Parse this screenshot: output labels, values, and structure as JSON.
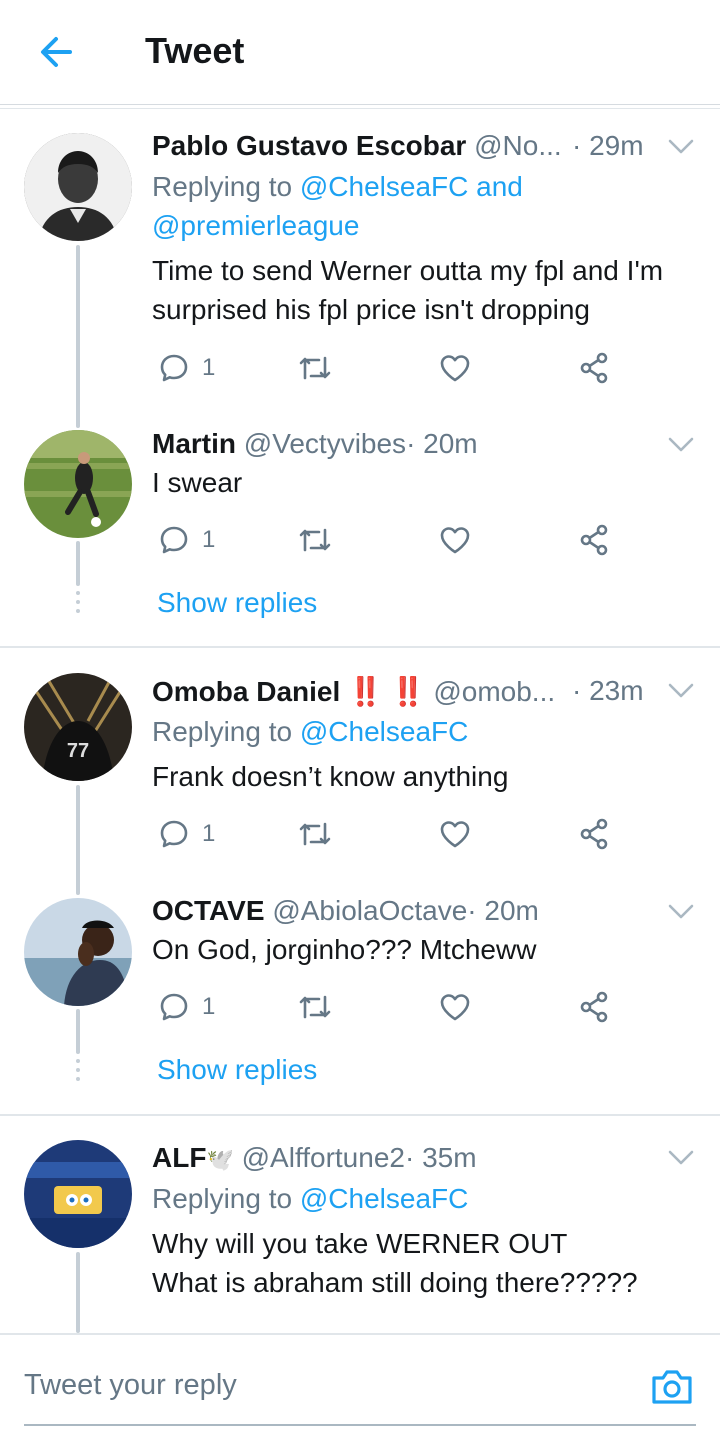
{
  "header": {
    "title": "Tweet"
  },
  "tweets": [
    {
      "name": "Pablo Gustavo Escobar",
      "handle": "@No...",
      "time": "· 29m",
      "replying_label": "Replying to",
      "replying_to": "@ChelseaFC",
      "replying_and": " and",
      "replying_to2": "@premierleague",
      "text": [
        "Time to send Werner outta my fpl and I'm",
        "surprised his fpl price isn't dropping"
      ],
      "reply_count": "1"
    },
    {
      "name": "Martin",
      "handle": "@Vectyvibes",
      "time": "· 20m",
      "text": [
        "I swear"
      ],
      "reply_count": "1",
      "show_replies": "Show replies"
    },
    {
      "name": "Omoba Daniel",
      "emoji": "‼️ ‼️",
      "handle": "@omob...",
      "time": "· 23m",
      "replying_label": "Replying to",
      "replying_to": "@ChelseaFC",
      "text": [
        "Frank doesn’t know anything"
      ],
      "reply_count": "1"
    },
    {
      "name": "OCTAVE",
      "handle": "@AbiolaOctave",
      "time": "· 20m",
      "text": [
        "On God, jorginho??? Mtcheww"
      ],
      "reply_count": "1",
      "show_replies": "Show replies"
    },
    {
      "name": "ALF",
      "emoji": "🕊️",
      "handle": "@Alffortune2",
      "time": "· 35m",
      "replying_label": "Replying to",
      "replying_to": "@ChelseaFC",
      "text": [
        "Why will you take WERNER OUT",
        "What is abraham still doing there?????"
      ]
    }
  ],
  "footer": {
    "reply_placeholder": "Tweet your reply"
  },
  "colors": {
    "accent": "#1da1f2",
    "muted": "#657786",
    "text": "#14171a",
    "line": "#e1e6ea"
  },
  "icons": {
    "back": "back-arrow-icon",
    "chevron": "chevron-down-icon",
    "reply": "reply-icon",
    "retweet": "retweet-icon",
    "like": "heart-icon",
    "share": "share-icon",
    "camera": "camera-icon"
  }
}
